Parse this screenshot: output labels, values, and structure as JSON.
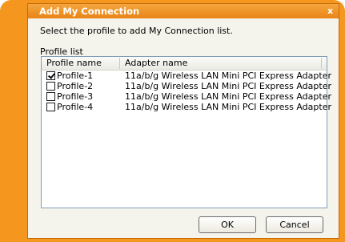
{
  "dialog": {
    "title": "Add My Connection",
    "close_glyph": "x",
    "instruction": "Select the profile to add My Connection list.",
    "group_label": "Profile list"
  },
  "list": {
    "columns": [
      "Profile name",
      "Adapter name"
    ],
    "rows": [
      {
        "profile": "Profile-1",
        "adapter": "11a/b/g Wireless LAN Mini PCI Express Adapter",
        "checked": true
      },
      {
        "profile": "Profile-2",
        "adapter": "11a/b/g Wireless LAN Mini PCI Express Adapter",
        "checked": false
      },
      {
        "profile": "Profile-3",
        "adapter": "11a/b/g Wireless LAN Mini PCI Express Adapter",
        "checked": false
      },
      {
        "profile": "Profile-4",
        "adapter": "11a/b/g Wireless LAN Mini PCI Express Adapter",
        "checked": false
      }
    ]
  },
  "buttons": {
    "ok": "OK",
    "cancel": "Cancel"
  },
  "colors": {
    "accent": "#f5961e",
    "title_bar": "#ea8416",
    "dialog_bg": "#f4f3ec"
  },
  "icons": {
    "close": "close-icon",
    "checkbox": "checkbox-icon"
  }
}
